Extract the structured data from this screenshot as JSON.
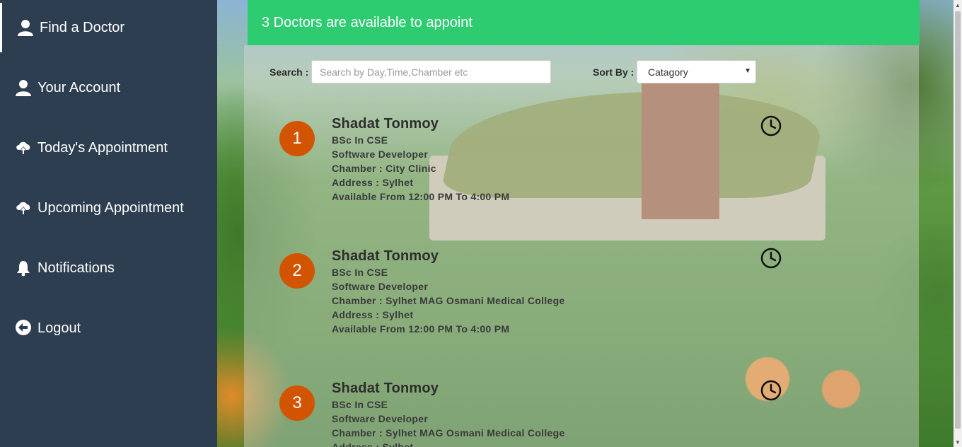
{
  "sidebar": {
    "items": [
      {
        "label": "Find a Doctor",
        "icon": "user-icon",
        "active": true
      },
      {
        "label": "Your Account",
        "icon": "user-icon"
      },
      {
        "label": "Today's Appointment",
        "icon": "cloud-upload-icon"
      },
      {
        "label": "Upcoming Appointment",
        "icon": "cloud-upload-icon"
      },
      {
        "label": "Notifications",
        "icon": "bell-icon"
      },
      {
        "label": "Logout",
        "icon": "circle-arrow-left-icon"
      }
    ]
  },
  "banner": {
    "text": "3 Doctors are available to appoint"
  },
  "search": {
    "label": "Search :",
    "placeholder": "Search by Day,Time,Chamber etc",
    "value": ""
  },
  "sort": {
    "label": "Sort By :",
    "selected": "Catagory"
  },
  "doctors": [
    {
      "number": "1",
      "name": "Shadat Tonmoy",
      "degree": "BSc In CSE",
      "profession": "Software Developer",
      "chamber": "Chamber : City Clinic",
      "address": "Address : Sylhet",
      "availability": "Available From 12:00 PM To 4:00 PM"
    },
    {
      "number": "2",
      "name": "Shadat Tonmoy",
      "degree": "BSc In CSE",
      "profession": "Software Developer",
      "chamber": "Chamber : Sylhet MAG Osmani Medical College",
      "address": "Address : Sylhet",
      "availability": "Available From 12:00 PM To 4:00 PM"
    },
    {
      "number": "3",
      "name": "Shadat Tonmoy",
      "degree": "BSc In CSE",
      "profession": "Software Developer",
      "chamber": "Chamber : Sylhet MAG Osmani Medical College",
      "address": "Address : Sylhet",
      "availability": ""
    }
  ],
  "colors": {
    "sidebar_bg": "#2d3e50",
    "banner_bg": "#2ecc71",
    "badge_bg": "#d35400"
  }
}
